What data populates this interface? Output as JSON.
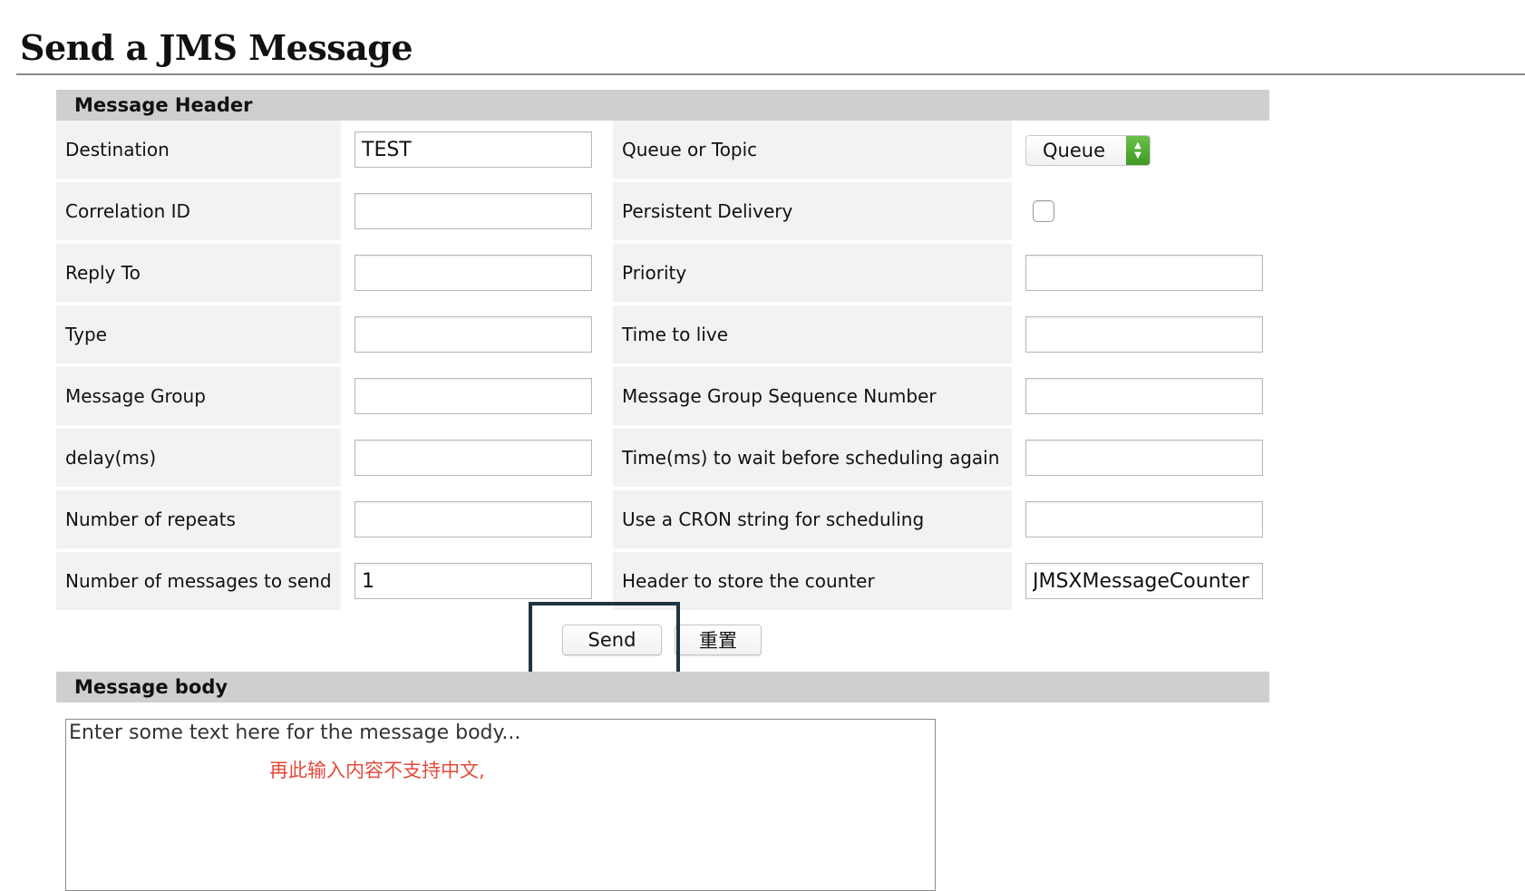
{
  "page": {
    "title": "Send a JMS Message"
  },
  "header_section": {
    "label": "Message Header"
  },
  "fields": {
    "destination": {
      "label": "Destination",
      "value": "TEST"
    },
    "correlation_id": {
      "label": "Correlation ID",
      "value": ""
    },
    "reply_to": {
      "label": "Reply To",
      "value": ""
    },
    "type": {
      "label": "Type",
      "value": ""
    },
    "message_group": {
      "label": "Message Group",
      "value": ""
    },
    "delay": {
      "label": "delay(ms)",
      "value": ""
    },
    "repeats": {
      "label": "Number of repeats",
      "value": ""
    },
    "messages_to_send": {
      "label": "Number of messages to send",
      "value": "1"
    },
    "queue_or_topic": {
      "label": "Queue or Topic",
      "value": "Queue",
      "accent": "#4caf2f"
    },
    "persistent": {
      "label": "Persistent Delivery",
      "checked": false
    },
    "priority": {
      "label": "Priority",
      "value": ""
    },
    "time_to_live": {
      "label": "Time to live",
      "value": ""
    },
    "group_seq": {
      "label": "Message Group Sequence Number",
      "value": ""
    },
    "wait_time": {
      "label": "Time(ms) to wait before scheduling again",
      "value": ""
    },
    "cron": {
      "label": "Use a CRON string for scheduling",
      "value": ""
    },
    "counter_header": {
      "label": "Header to store the counter",
      "value": "JMSXMessageCounter"
    }
  },
  "buttons": {
    "send": "Send",
    "reset": "重置"
  },
  "body_section": {
    "label": "Message body",
    "text": "Enter some text here for the message body...",
    "annotation": "再此输入内容不支持中文,",
    "annotation_color": "#e34b3b",
    "highlight_color": "#1f3440"
  }
}
